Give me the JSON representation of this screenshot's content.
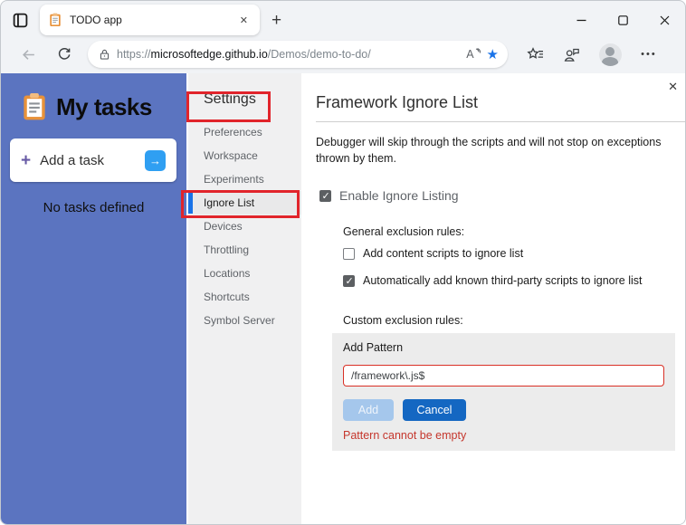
{
  "browser": {
    "tab": {
      "title": "TODO app"
    },
    "new_tab_glyph": "+",
    "tab_close_glyph": "✕",
    "address": {
      "scheme": "https://",
      "host": "microsoftedge.github.io",
      "path": "/Demos/demo-to-do/",
      "read_aloud_glyph": "A",
      "favorite_star_glyph": "★"
    },
    "more_glyph": "•••"
  },
  "app": {
    "title": "My tasks",
    "add_button": {
      "plus_glyph": "+",
      "label": "Add a task",
      "arrow_glyph": "→"
    },
    "empty_message": "No tasks defined"
  },
  "settings": {
    "title": "Settings",
    "items": [
      {
        "label": "Preferences"
      },
      {
        "label": "Workspace"
      },
      {
        "label": "Experiments"
      },
      {
        "label": "Ignore List"
      },
      {
        "label": "Devices"
      },
      {
        "label": "Throttling"
      },
      {
        "label": "Locations"
      },
      {
        "label": "Shortcuts"
      },
      {
        "label": "Symbol Server"
      }
    ],
    "selected_item": "Ignore List"
  },
  "dialog": {
    "close_glyph": "✕",
    "title": "Framework Ignore List",
    "description": "Debugger will skip through the scripts and will not stop on exceptions thrown by them.",
    "enable_label": "Enable Ignore Listing",
    "general_rules_label": "General exclusion rules:",
    "checkbox_content_scripts": "Add content scripts to ignore list",
    "checkbox_third_party": "Automatically add known third-party scripts to ignore list",
    "custom_rules_label": "Custom exclusion rules:",
    "add_pattern_label": "Add Pattern",
    "pattern_value": "/framework\\.js$",
    "add_button": "Add",
    "cancel_button": "Cancel",
    "error_message": "Pattern cannot be empty"
  },
  "colors": {
    "sidebar_blue": "#5b74c0",
    "accent_blue": "#1a73e8",
    "cancel_button_blue": "#1467c2",
    "annotation_red": "#e1242b",
    "error_red": "#c5362c",
    "input_error_border": "#d93025"
  }
}
